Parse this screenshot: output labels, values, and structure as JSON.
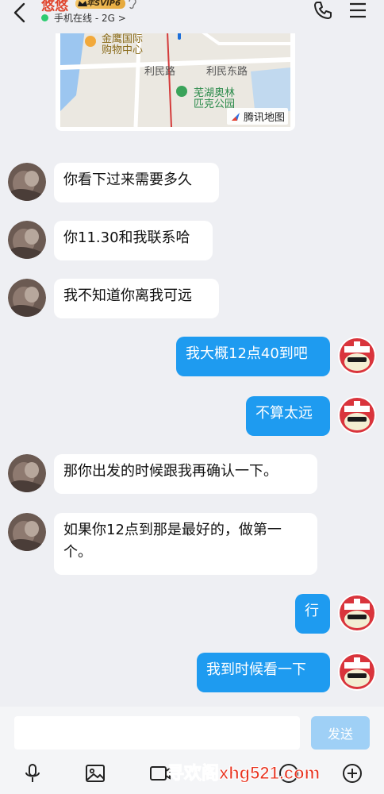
{
  "header": {
    "contact_name": "悠悠",
    "vip_label": "年SVIP6",
    "online_status": "手机在线 - 2G >"
  },
  "map": {
    "labels": {
      "mall_1": "金鹰国际",
      "mall_2": "购物中心",
      "road_1": "利民路",
      "road_2": "利民东路",
      "park_1": "芜湖奥林",
      "park_2": "匹克公园"
    },
    "provider": "腾讯地图"
  },
  "messages": [
    {
      "side": "in",
      "text": "你看下过来需要多久"
    },
    {
      "side": "in",
      "text": "你11.30和我联系哈"
    },
    {
      "side": "in",
      "text": "我不知道你离我可远"
    },
    {
      "side": "out",
      "text": "我大概12点40到吧"
    },
    {
      "side": "out",
      "text": "不算太远"
    },
    {
      "side": "in",
      "text": "那你出发的时候跟我再确认一下。"
    },
    {
      "side": "in",
      "text": "如果你12点到那是最好的，做第一个。"
    },
    {
      "side": "out",
      "text": "行"
    },
    {
      "side": "out",
      "text": "我到时候看一下"
    }
  ],
  "input": {
    "value": "",
    "send_label": "发送"
  },
  "toolbar": {
    "icons": [
      "microphone-icon",
      "image-icon",
      "video-icon",
      "emoji-icon",
      "plus-icon"
    ]
  },
  "watermark": "寻欢阁xhg521.com",
  "colors": {
    "outgoing_bubble": "#1e9bf0",
    "incoming_bubble": "#ffffff",
    "send_button": "#9fd0f6",
    "contact_name": "#e0452e",
    "online_dot": "#2ecc71"
  }
}
